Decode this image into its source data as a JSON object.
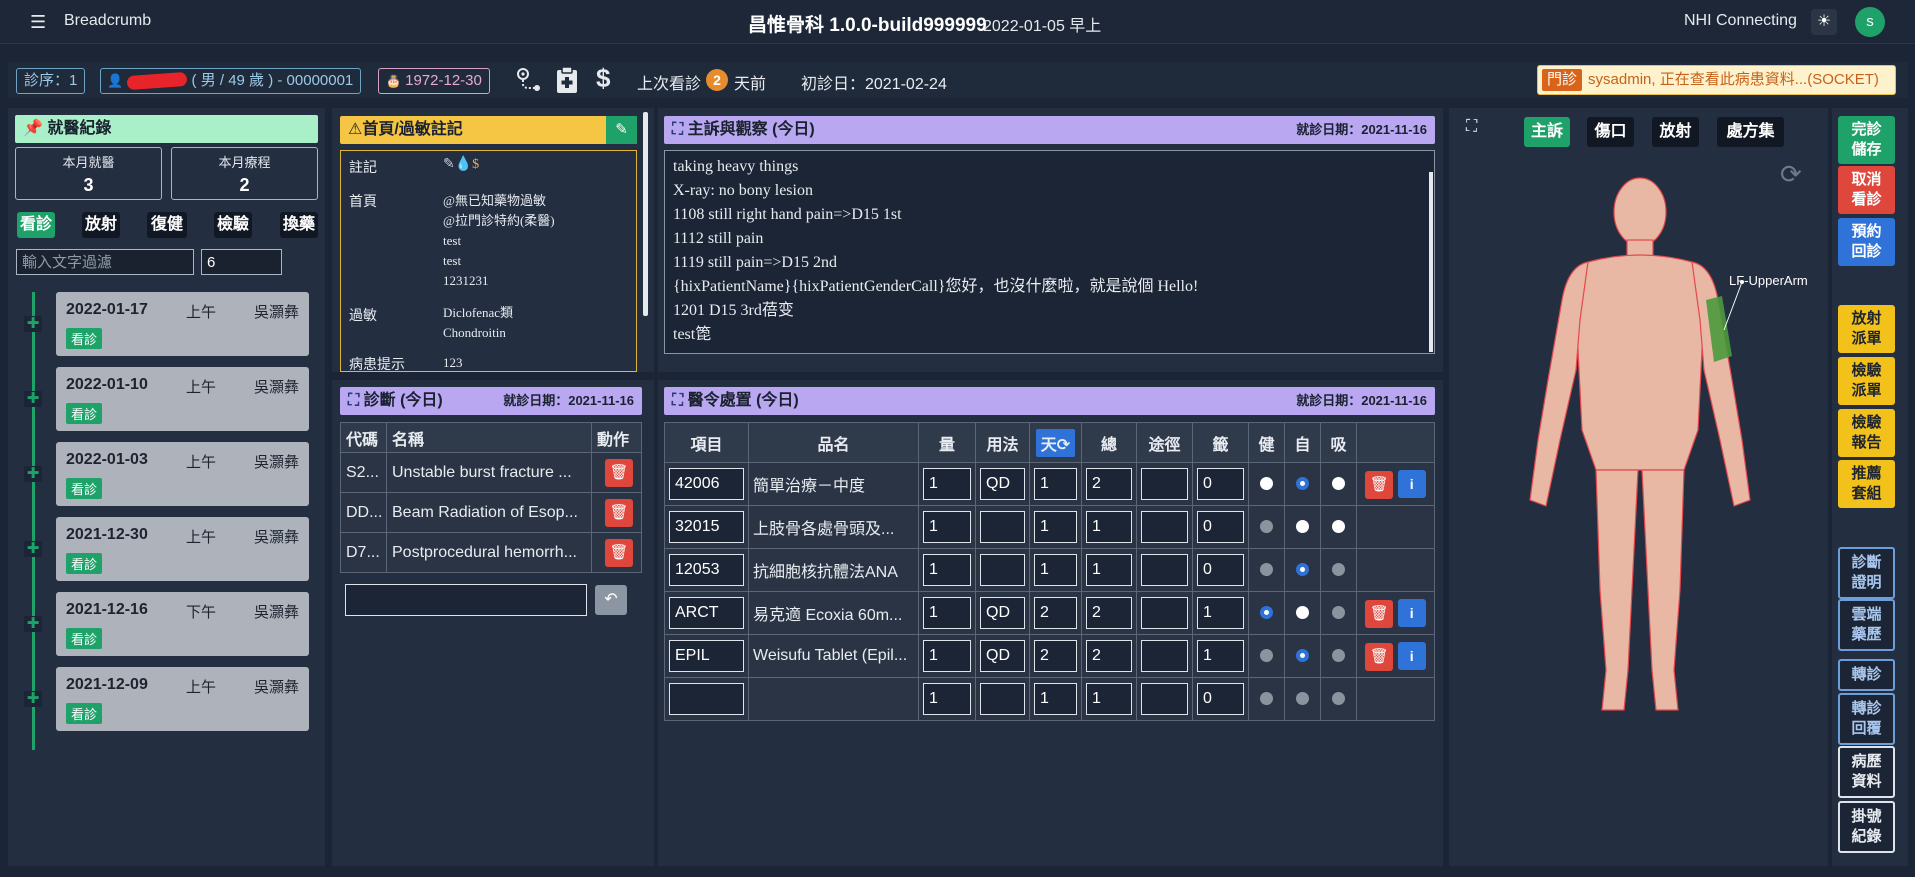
{
  "topbar": {
    "breadcrumb": "Breadcrumb",
    "app_title": "昌惟骨科 1.0.0-build999999",
    "datetime": "2022-01-05 早上",
    "connection": "NHI Connecting",
    "theme_icon": "sun-icon",
    "user_initial": "s"
  },
  "patient": {
    "seq": "診序：1",
    "info": "( 男 / 49 歲 ) - 00000001",
    "birthday": "1972-12-30",
    "last_visit_label": "上次看診",
    "last_visit_days": "2",
    "last_visit_unit": "天前",
    "first_visit": "初診日：2021-02-24",
    "socket_tag": "門診",
    "socket_msg": "sysadmin, 正在查看此病患資料...(SOCKET)"
  },
  "history": {
    "title": "就醫紀錄",
    "month_visits_label": "本月就醫",
    "month_visits": "3",
    "month_course_label": "本月療程",
    "month_course": "2",
    "tabs": [
      "看診",
      "放射",
      "復健",
      "檢驗",
      "換藥"
    ],
    "filter_placeholder": "輸入文字過濾",
    "count_value": "6",
    "visits": [
      {
        "date": "2022-01-17",
        "period": "上午",
        "doctor": "吳灝彝",
        "type": "看診"
      },
      {
        "date": "2022-01-10",
        "period": "上午",
        "doctor": "吳灝彝",
        "type": "看診"
      },
      {
        "date": "2022-01-03",
        "period": "上午",
        "doctor": "吳灝彝",
        "type": "看診"
      },
      {
        "date": "2021-12-30",
        "period": "上午",
        "doctor": "吳灝彝",
        "type": "看診"
      },
      {
        "date": "2021-12-16",
        "period": "下午",
        "doctor": "吳灝彝",
        "type": "看診"
      },
      {
        "date": "2021-12-09",
        "period": "上午",
        "doctor": "吳灝彝",
        "type": "看診"
      }
    ]
  },
  "notes": {
    "title": "首頁/過敏註記",
    "remark_label": "註記",
    "home_label": "首頁",
    "home_lines": [
      "@無已知藥物過敏",
      "@拉門診特約(柔醫)",
      "test",
      "test",
      "1231231"
    ],
    "allergy_label": "過敏",
    "allergy_lines": [
      "Diclofenac類",
      "Chondroitin"
    ],
    "hint_label": "病患提示",
    "hint_value": "123"
  },
  "complaint": {
    "title": "主訴與觀察 (今日)",
    "date": "就診日期：2021-11-16",
    "lines": [
      "taking heavy things",
      "X-ray: no bony lesion",
      "1108 still right hand pain=>D15 1st",
      "1112 still pain",
      "1119 still pain=>D15 2nd",
      "{hixPatientName}{hixPatientGenderCall}您好，也沒什麼啦，就是說個 Hello!",
      "1201 D15 3rd蓓变",
      "test箆"
    ]
  },
  "diagnosis": {
    "title": "診斷 (今日)",
    "date": "就診日期：2021-11-16",
    "headers": [
      "代碼",
      "名稱",
      "動作"
    ],
    "rows": [
      {
        "code": "S2...",
        "name": "Unstable burst fracture ..."
      },
      {
        "code": "DD...",
        "name": "Beam Radiation of Esop..."
      },
      {
        "code": "D7...",
        "name": "Postprocedural hemorrh..."
      }
    ]
  },
  "orders": {
    "title": "醫令處置 (今日)",
    "date": "就診日期：2021-11-16",
    "headers": [
      "項目",
      "品名",
      "量",
      "用法",
      "天",
      "總",
      "途徑",
      "籤",
      "健",
      "自",
      "吸"
    ],
    "rows": [
      {
        "code": "42006",
        "name": "簡單治療－中度",
        "qty": "1",
        "usage": "QD",
        "days": "1",
        "total": "2",
        "route": "",
        "label": "0",
        "radio": [
          0,
          1,
          0
        ],
        "actions": true
      },
      {
        "code": "32015",
        "name": "上肢骨各處骨頭及...",
        "qty": "1",
        "usage": "",
        "days": "1",
        "total": "1",
        "route": "",
        "label": "0",
        "radio": [
          -1,
          0,
          0
        ],
        "actions": false
      },
      {
        "code": "12053",
        "name": "抗細胞核抗體法ANA",
        "qty": "1",
        "usage": "",
        "days": "1",
        "total": "1",
        "route": "",
        "label": "0",
        "radio": [
          -1,
          1,
          -1
        ],
        "actions": false
      },
      {
        "code": "ARCT",
        "name": "易克適 Ecoxia 60m...",
        "qty": "1",
        "usage": "QD",
        "days": "2",
        "total": "2",
        "route": "",
        "label": "1",
        "radio": [
          1,
          0,
          -1
        ],
        "actions": true
      },
      {
        "code": "EPIL",
        "name": "Weisufu Tablet (Epil...",
        "qty": "1",
        "usage": "QD",
        "days": "2",
        "total": "2",
        "route": "",
        "label": "1",
        "radio": [
          -1,
          1,
          -1
        ],
        "actions": true
      },
      {
        "code": "",
        "name": "",
        "qty": "1",
        "usage": "",
        "days": "1",
        "total": "1",
        "route": "",
        "label": "0",
        "radio": [
          -1,
          -1,
          -1
        ],
        "actions": false
      }
    ]
  },
  "bodymap": {
    "tabs": [
      "主訴",
      "傷口",
      "放射",
      "處方集"
    ],
    "label": "LF-UpperArm"
  },
  "actions": [
    {
      "label": "完診儲存",
      "style": "green"
    },
    {
      "label": "取消看診",
      "style": "red"
    },
    {
      "label": "預約回診",
      "style": "blue"
    },
    {
      "label": "放射派單",
      "style": "yellow"
    },
    {
      "label": "檢驗派單",
      "style": "yellow"
    },
    {
      "label": "檢驗報告",
      "style": "yellow"
    },
    {
      "label": "推薦套組",
      "style": "yellow"
    },
    {
      "label": "診斷證明",
      "style": "ob"
    },
    {
      "label": "雲端藥歷",
      "style": "ob"
    },
    {
      "label": "轉診",
      "style": "ob"
    },
    {
      "label": "轉診回覆",
      "style": "ob"
    },
    {
      "label": "病歷資料",
      "style": "ow"
    },
    {
      "label": "掛號紀錄",
      "style": "ow"
    }
  ],
  "colors": {
    "accent_green": "#1fa269",
    "danger": "#e0473c",
    "primary": "#2f73d9",
    "warning": "#f2c21b",
    "section_purple": "#b9a7f2",
    "section_yellow": "#f5c544",
    "section_mint": "#a9f0c9"
  }
}
